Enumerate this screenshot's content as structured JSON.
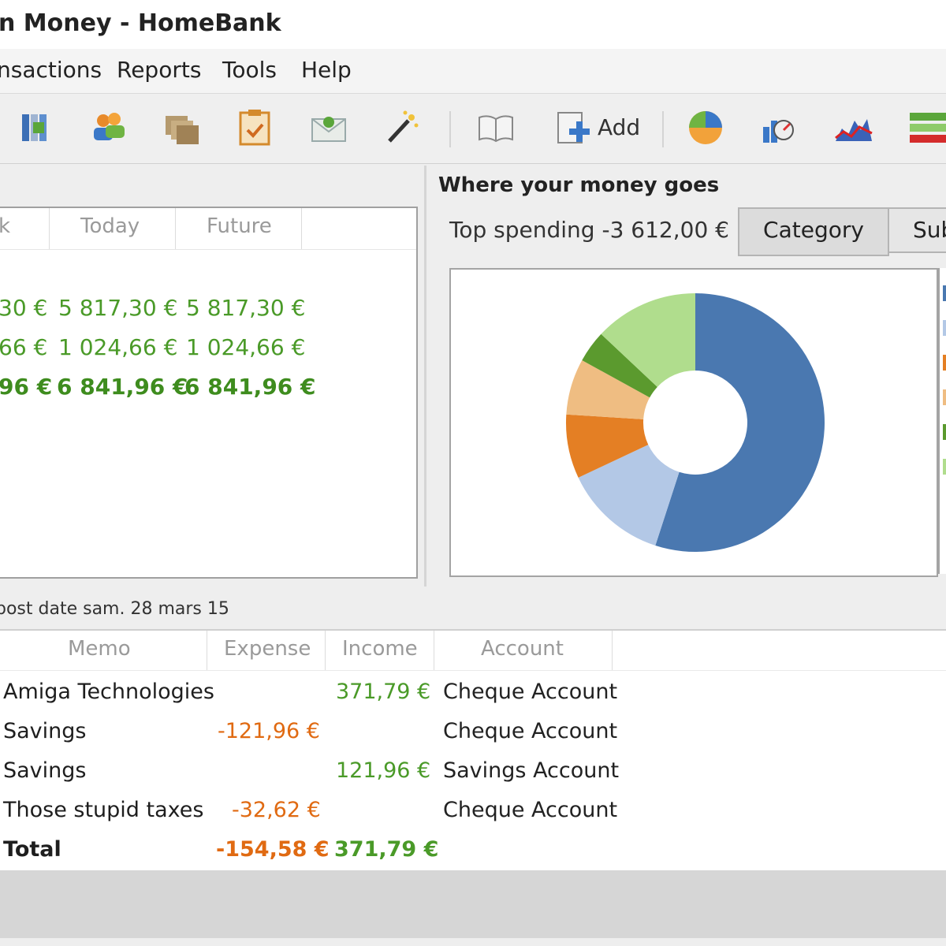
{
  "window": {
    "title": "n Money - HomeBank"
  },
  "menu": [
    "nsactions",
    "Reports",
    "Tools",
    "Help"
  ],
  "toolbar": {
    "icons": [
      "accounts-icon",
      "payees-icon",
      "categories-icon",
      "archives-icon",
      "budget-icon",
      "assistant-wand-icon",
      "register-book-icon",
      "add-transaction-icon",
      "statistics-pie-icon",
      "budget-report-icon",
      "balance-report-icon",
      "trend-report-icon"
    ],
    "add_label": "Add"
  },
  "accounts": {
    "columns": [
      "k",
      "Today",
      "Future"
    ],
    "rows": [
      [
        "30 €",
        "5 817,30 €",
        "5 817,30 €"
      ],
      [
        "66 €",
        "1 024,66 €",
        "1 024,66 €"
      ],
      [
        "96 €",
        "6 841,96 €",
        "6 841,96 €"
      ]
    ]
  },
  "spending": {
    "title": "Where your money goes",
    "top_label": "Top spending",
    "top_value": "-3 612,00 €",
    "tabs": [
      "Category",
      "Sub"
    ]
  },
  "chart_data": {
    "type": "pie",
    "donut": true,
    "values": [
      55,
      13,
      8,
      7,
      4,
      13
    ],
    "colors": [
      "#4a78b0",
      "#b3c8e6",
      "#e47f24",
      "#efbd82",
      "#5b9a2e",
      "#b0dd8d"
    ],
    "legend_colors": [
      "#4a78b0",
      "#b3c8e6",
      "#e47f24",
      "#efbd82",
      "#5b9a2e",
      "#b0dd8d"
    ]
  },
  "transactions": {
    "post_date": "post date  sam. 28 mars 15",
    "columns": [
      "Memo",
      "Expense",
      "Income",
      "Account"
    ],
    "rows": [
      {
        "memo": "Amiga Technologies",
        "expense": "",
        "income": "371,79 €",
        "account": "Cheque Account"
      },
      {
        "memo": "Savings",
        "expense": "-121,96 €",
        "income": "",
        "account": "Cheque Account"
      },
      {
        "memo": "Savings",
        "expense": "",
        "income": "121,96 €",
        "account": "Savings Account"
      },
      {
        "memo": "Those stupid taxes",
        "expense": "-32,62 €",
        "income": "",
        "account": "Cheque Account"
      }
    ],
    "total": {
      "label": "Total",
      "expense": "-154,58 €",
      "income": "371,79 €"
    }
  }
}
